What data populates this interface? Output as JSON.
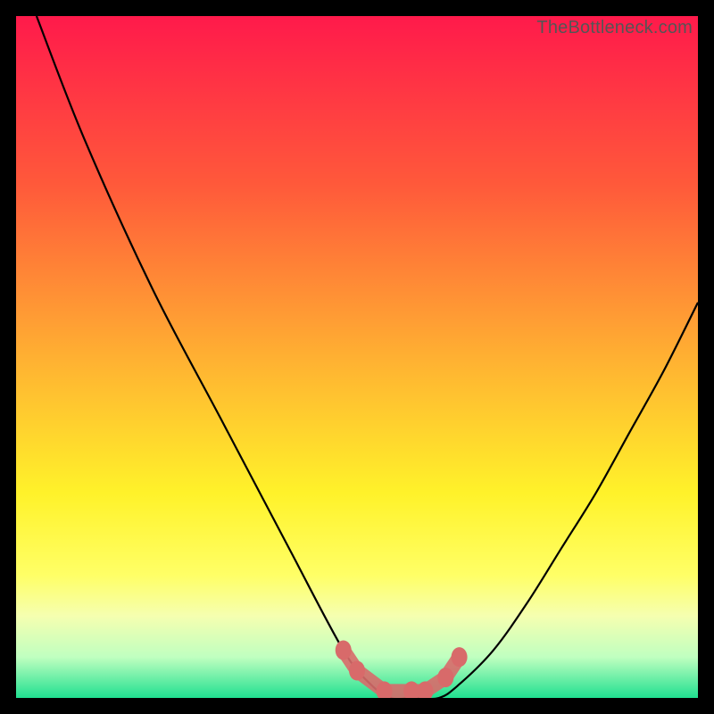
{
  "watermark": "TheBottleneck.com",
  "chart_data": {
    "type": "line",
    "title": "",
    "xlabel": "",
    "ylabel": "",
    "xlim": [
      0,
      100
    ],
    "ylim": [
      0,
      100
    ],
    "grid": false,
    "legend": false,
    "series": [
      {
        "name": "bottleneck-curve",
        "color": "#000000",
        "x": [
          3,
          10,
          20,
          30,
          40,
          48,
          52,
          55,
          58,
          62,
          65,
          70,
          75,
          80,
          85,
          90,
          95,
          100
        ],
        "y": [
          100,
          82,
          60,
          41,
          22,
          7,
          2,
          0,
          0,
          0,
          2,
          7,
          14,
          22,
          30,
          39,
          48,
          58
        ]
      }
    ],
    "markers": [
      {
        "name": "highlight-points",
        "color": "#d86a6a",
        "x": [
          48,
          50,
          54,
          58,
          60,
          63,
          65
        ],
        "y": [
          7,
          4,
          1,
          1,
          1,
          3,
          6
        ]
      }
    ],
    "background_gradient": {
      "stops": [
        {
          "pos": 0.0,
          "color": "#ff1a4b"
        },
        {
          "pos": 0.25,
          "color": "#ff5a3a"
        },
        {
          "pos": 0.5,
          "color": "#ffb032"
        },
        {
          "pos": 0.7,
          "color": "#fff22a"
        },
        {
          "pos": 0.82,
          "color": "#ffff66"
        },
        {
          "pos": 0.88,
          "color": "#f5ffb0"
        },
        {
          "pos": 0.94,
          "color": "#c0ffc0"
        },
        {
          "pos": 1.0,
          "color": "#20e090"
        }
      ]
    }
  }
}
